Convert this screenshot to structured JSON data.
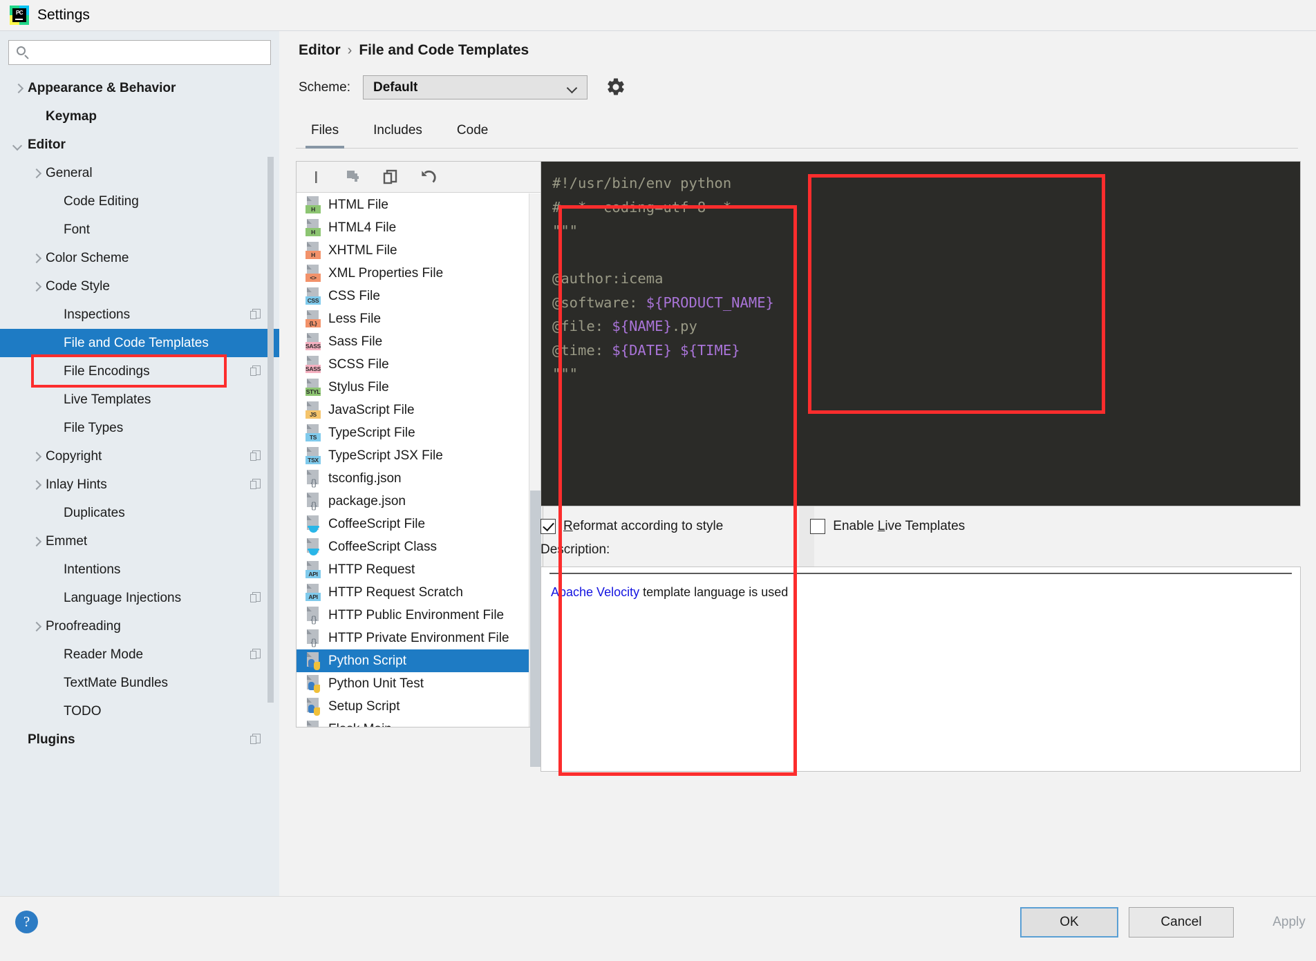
{
  "window": {
    "title": "Settings",
    "logo_text": "PC"
  },
  "search": {
    "value": "",
    "placeholder": ""
  },
  "sidebar": {
    "items": [
      {
        "label": "Appearance & Behavior",
        "arrow": "closed",
        "bold": true,
        "indent": 18,
        "badge": false,
        "selected": false
      },
      {
        "label": "Keymap",
        "arrow": "none",
        "bold": true,
        "indent": 44,
        "badge": false,
        "selected": false
      },
      {
        "label": "Editor",
        "arrow": "open",
        "bold": true,
        "indent": 18,
        "badge": false,
        "selected": false
      },
      {
        "label": "General",
        "arrow": "closed",
        "bold": false,
        "indent": 44,
        "badge": false,
        "selected": false
      },
      {
        "label": "Code Editing",
        "arrow": "none",
        "bold": false,
        "indent": 70,
        "badge": false,
        "selected": false
      },
      {
        "label": "Font",
        "arrow": "none",
        "bold": false,
        "indent": 70,
        "badge": false,
        "selected": false
      },
      {
        "label": "Color Scheme",
        "arrow": "closed",
        "bold": false,
        "indent": 44,
        "badge": false,
        "selected": false
      },
      {
        "label": "Code Style",
        "arrow": "closed",
        "bold": false,
        "indent": 44,
        "badge": false,
        "selected": false
      },
      {
        "label": "Inspections",
        "arrow": "none",
        "bold": false,
        "indent": 70,
        "badge": true,
        "selected": false
      },
      {
        "label": "File and Code Templates",
        "arrow": "none",
        "bold": false,
        "indent": 70,
        "badge": false,
        "selected": true
      },
      {
        "label": "File Encodings",
        "arrow": "none",
        "bold": false,
        "indent": 70,
        "badge": true,
        "selected": false
      },
      {
        "label": "Live Templates",
        "arrow": "none",
        "bold": false,
        "indent": 70,
        "badge": false,
        "selected": false
      },
      {
        "label": "File Types",
        "arrow": "none",
        "bold": false,
        "indent": 70,
        "badge": false,
        "selected": false
      },
      {
        "label": "Copyright",
        "arrow": "closed",
        "bold": false,
        "indent": 44,
        "badge": true,
        "selected": false
      },
      {
        "label": "Inlay Hints",
        "arrow": "closed",
        "bold": false,
        "indent": 44,
        "badge": true,
        "selected": false
      },
      {
        "label": "Duplicates",
        "arrow": "none",
        "bold": false,
        "indent": 70,
        "badge": false,
        "selected": false
      },
      {
        "label": "Emmet",
        "arrow": "closed",
        "bold": false,
        "indent": 44,
        "badge": false,
        "selected": false
      },
      {
        "label": "Intentions",
        "arrow": "none",
        "bold": false,
        "indent": 70,
        "badge": false,
        "selected": false
      },
      {
        "label": "Language Injections",
        "arrow": "none",
        "bold": false,
        "indent": 70,
        "badge": true,
        "selected": false
      },
      {
        "label": "Proofreading",
        "arrow": "closed",
        "bold": false,
        "indent": 44,
        "badge": false,
        "selected": false
      },
      {
        "label": "Reader Mode",
        "arrow": "none",
        "bold": false,
        "indent": 70,
        "badge": true,
        "selected": false
      },
      {
        "label": "TextMate Bundles",
        "arrow": "none",
        "bold": false,
        "indent": 70,
        "badge": false,
        "selected": false
      },
      {
        "label": "TODO",
        "arrow": "none",
        "bold": false,
        "indent": 70,
        "badge": false,
        "selected": false
      },
      {
        "label": "Plugins",
        "arrow": "none",
        "bold": true,
        "indent": 18,
        "badge": true,
        "selected": false
      }
    ]
  },
  "header": {
    "breadcrumb": [
      "Editor",
      "File and Code Templates"
    ],
    "separator": "›",
    "scheme_label": "Scheme:",
    "scheme_value": "Default"
  },
  "tabs": [
    {
      "label": "Files",
      "active": true
    },
    {
      "label": "Includes",
      "active": false
    },
    {
      "label": "Code",
      "active": false
    }
  ],
  "list_toolbar": {
    "buttons": [
      "add-icon",
      "copy-template-icon",
      "duplicate-icon",
      "reset-icon"
    ]
  },
  "file_list": {
    "items": [
      {
        "label": "HTML File",
        "icon": "html-file-icon",
        "tag": "H",
        "tagbg": "#8dc572",
        "selected": false
      },
      {
        "label": "HTML4 File",
        "icon": "html4-file-icon",
        "tag": "H",
        "tagbg": "#8dc572",
        "selected": false
      },
      {
        "label": "XHTML File",
        "icon": "xhtml-file-icon",
        "tag": "H",
        "tagbg": "#f2926a",
        "selected": false
      },
      {
        "label": "XML Properties File",
        "icon": "xml-properties-icon",
        "tag": "<>",
        "tagbg": "#f2926a",
        "selected": false
      },
      {
        "label": "CSS File",
        "icon": "css-file-icon",
        "tag": "CSS",
        "tagbg": "#7fcaec",
        "selected": false
      },
      {
        "label": "Less File",
        "icon": "less-file-icon",
        "tag": "{L}",
        "tagbg": "#f2926a",
        "selected": false
      },
      {
        "label": "Sass File",
        "icon": "sass-file-icon",
        "tag": "SASS",
        "tagbg": "#f5b0c0",
        "selected": false
      },
      {
        "label": "SCSS File",
        "icon": "scss-file-icon",
        "tag": "SASS",
        "tagbg": "#f5b0c0",
        "selected": false
      },
      {
        "label": "Stylus File",
        "icon": "stylus-file-icon",
        "tag": "STYL",
        "tagbg": "#8dc572",
        "selected": false
      },
      {
        "label": "JavaScript File",
        "icon": "javascript-file-icon",
        "tag": "JS",
        "tagbg": "#f5c46b",
        "selected": false
      },
      {
        "label": "TypeScript File",
        "icon": "typescript-file-icon",
        "tag": "TS",
        "tagbg": "#7fcaec",
        "selected": false
      },
      {
        "label": "TypeScript JSX File",
        "icon": "typescript-jsx-icon",
        "tag": "TSX",
        "tagbg": "#7fcaec",
        "selected": false
      },
      {
        "label": "tsconfig.json",
        "icon": "json-file-icon",
        "tag": "{}",
        "tagbg": "",
        "selected": false
      },
      {
        "label": "package.json",
        "icon": "json-file-icon",
        "tag": "{}",
        "tagbg": "",
        "selected": false
      },
      {
        "label": "CoffeeScript File",
        "icon": "coffeescript-icon",
        "tag": "cup",
        "tagbg": "",
        "selected": false
      },
      {
        "label": "CoffeeScript Class",
        "icon": "coffeescript-icon",
        "tag": "cup",
        "tagbg": "",
        "selected": false
      },
      {
        "label": "HTTP Request",
        "icon": "http-request-icon",
        "tag": "API",
        "tagbg": "#7fcaec",
        "selected": false
      },
      {
        "label": "HTTP Request Scratch",
        "icon": "http-request-icon",
        "tag": "API",
        "tagbg": "#7fcaec",
        "selected": false
      },
      {
        "label": "HTTP Public Environment File",
        "icon": "json-file-icon",
        "tag": "{}",
        "tagbg": "",
        "selected": false
      },
      {
        "label": "HTTP Private Environment File",
        "icon": "json-file-icon",
        "tag": "{}",
        "tagbg": "",
        "selected": false
      },
      {
        "label": "Python Script",
        "icon": "python-file-icon",
        "tag": "py",
        "tagbg": "",
        "selected": true
      },
      {
        "label": "Python Unit Test",
        "icon": "python-file-icon",
        "tag": "py",
        "tagbg": "",
        "selected": false
      },
      {
        "label": "Setup Script",
        "icon": "python-file-icon",
        "tag": "py",
        "tagbg": "",
        "selected": false
      },
      {
        "label": "Flask Main",
        "icon": "python-file-icon",
        "tag": "py",
        "tagbg": "",
        "selected": false
      }
    ]
  },
  "editor": {
    "lines": [
      [
        {
          "t": "#!/usr/bin/env python",
          "c": "plain"
        }
      ],
      [
        {
          "t": "# -*- coding=utf-8 -*-",
          "c": "plain"
        }
      ],
      [
        {
          "t": "\"\"\"",
          "c": "plain"
        }
      ],
      [
        {
          "t": "",
          "c": "plain"
        }
      ],
      [
        {
          "t": "@author:icema",
          "c": "plain"
        }
      ],
      [
        {
          "t": "@software: ",
          "c": "plain"
        },
        {
          "t": "${PRODUCT_NAME}",
          "c": "var"
        }
      ],
      [
        {
          "t": "@file: ",
          "c": "plain"
        },
        {
          "t": "${NAME}",
          "c": "var"
        },
        {
          "t": ".py",
          "c": "plain"
        }
      ],
      [
        {
          "t": "@time: ",
          "c": "plain"
        },
        {
          "t": "${DATE}",
          "c": "var"
        },
        {
          "t": " ",
          "c": "plain"
        },
        {
          "t": "${TIME}",
          "c": "var"
        }
      ],
      [
        {
          "t": "\"\"\"",
          "c": "plain"
        }
      ]
    ]
  },
  "options": {
    "reformat": {
      "label_prefix": "",
      "label_underline": "R",
      "label_rest": "eformat according to style",
      "checked": true
    },
    "live_templates": {
      "label_prefix": "Enable ",
      "label_underline": "L",
      "label_rest": "ive Templates",
      "checked": false
    }
  },
  "description": {
    "label": "Description:",
    "link_text": "Apache Velocity",
    "rest_text": " template language is used"
  },
  "footer": {
    "help": "?",
    "ok": "OK",
    "cancel": "Cancel",
    "apply": "Apply"
  },
  "colors": {
    "accent_blue": "#1e7bc4",
    "highlight_red": "#fc2d2d",
    "sidebar_bg": "#e7ecf0",
    "editor_bg": "#2b2b28",
    "editor_comment": "#9a9a86",
    "editor_var": "#a974d8",
    "link_blue": "#1414e0"
  }
}
